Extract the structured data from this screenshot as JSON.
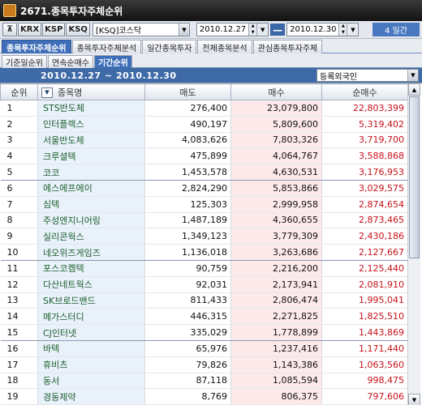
{
  "window": {
    "title": "2671.종목투자주체순위"
  },
  "toolbar": {
    "market_buttons": [
      {
        "label": "KRX",
        "active": false
      },
      {
        "label": "KSP",
        "active": false
      },
      {
        "label": "KSQ",
        "active": true
      }
    ],
    "market_select": "[KSQ]코스닥",
    "start_date": "2010.12.27",
    "end_date": "2010.12.30",
    "range_separator": "—",
    "period_label": "4 일간",
    "pin_icon": "pin-icon"
  },
  "tabs_main": [
    {
      "label": "종목투자주체순위",
      "active": true
    },
    {
      "label": "종목투자주체분석",
      "active": false
    },
    {
      "label": "일간종목투자",
      "active": false
    },
    {
      "label": "전체종목분석",
      "active": false
    },
    {
      "label": "관심종목투자주체",
      "active": false
    }
  ],
  "tabs_sub": [
    {
      "label": "기준일순위",
      "active": false
    },
    {
      "label": "연속순매수",
      "active": false
    },
    {
      "label": "기간순위",
      "active": true
    }
  ],
  "date_range": "2010.12.27 ~ 2010.12.30",
  "investor_filter": "등록외국인",
  "table": {
    "headers": {
      "rank": "순위",
      "name": "종목명",
      "sell": "매도",
      "buy": "매수",
      "net": "순매수"
    },
    "rows": [
      {
        "rank": "1",
        "name": "STS반도체",
        "sell": "276,400",
        "buy": "23,079,800",
        "net": "22,803,399"
      },
      {
        "rank": "2",
        "name": "인터플렉스",
        "sell": "490,197",
        "buy": "5,809,600",
        "net": "5,319,402"
      },
      {
        "rank": "3",
        "name": "서울반도체",
        "sell": "4,083,626",
        "buy": "7,803,326",
        "net": "3,719,700"
      },
      {
        "rank": "4",
        "name": "크루셜텍",
        "sell": "475,899",
        "buy": "4,064,767",
        "net": "3,588,868"
      },
      {
        "rank": "5",
        "name": "코코",
        "sell": "1,453,578",
        "buy": "4,630,531",
        "net": "3,176,953"
      },
      {
        "rank": "6",
        "name": "에스에프에이",
        "sell": "2,824,290",
        "buy": "5,853,866",
        "net": "3,029,575"
      },
      {
        "rank": "7",
        "name": "심텍",
        "sell": "125,303",
        "buy": "2,999,958",
        "net": "2,874,654"
      },
      {
        "rank": "8",
        "name": "주성엔지니어링",
        "sell": "1,487,189",
        "buy": "4,360,655",
        "net": "2,873,465"
      },
      {
        "rank": "9",
        "name": "실리콘웍스",
        "sell": "1,349,123",
        "buy": "3,779,309",
        "net": "2,430,186"
      },
      {
        "rank": "10",
        "name": "네오위즈게임즈",
        "sell": "1,136,018",
        "buy": "3,263,686",
        "net": "2,127,667"
      },
      {
        "rank": "11",
        "name": "포스코켐텍",
        "sell": "90,759",
        "buy": "2,216,200",
        "net": "2,125,440"
      },
      {
        "rank": "12",
        "name": "다산네트웍스",
        "sell": "92,031",
        "buy": "2,173,941",
        "net": "2,081,910"
      },
      {
        "rank": "13",
        "name": "SK브로드밴드",
        "sell": "811,433",
        "buy": "2,806,474",
        "net": "1,995,041"
      },
      {
        "rank": "14",
        "name": "메가스터디",
        "sell": "446,315",
        "buy": "2,271,825",
        "net": "1,825,510"
      },
      {
        "rank": "15",
        "name": "CJ인터넷",
        "sell": "335,029",
        "buy": "1,778,899",
        "net": "1,443,869"
      },
      {
        "rank": "16",
        "name": "바텍",
        "sell": "65,976",
        "buy": "1,237,416",
        "net": "1,171,440"
      },
      {
        "rank": "17",
        "name": "휴비츠",
        "sell": "79,826",
        "buy": "1,143,386",
        "net": "1,063,560"
      },
      {
        "rank": "18",
        "name": "동서",
        "sell": "87,118",
        "buy": "1,085,594",
        "net": "998,475"
      },
      {
        "rank": "19",
        "name": "경동제약",
        "sell": "8,769",
        "buy": "806,375",
        "net": "797,606"
      }
    ]
  },
  "colors": {
    "title_bg": "#1e1e1e",
    "tab_active": "#3f6fb8",
    "net_text": "#c8101a",
    "buy_bg": "#fde9ea",
    "name_bg": "#e9f1fb",
    "name_text": "#1b5e2a"
  }
}
